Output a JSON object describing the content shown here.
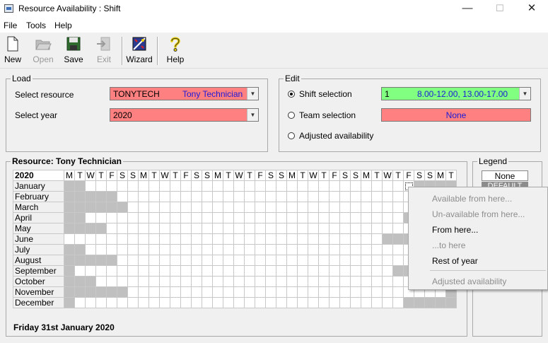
{
  "window": {
    "title": "Resource Availability : Shift",
    "minimize": "—",
    "maximize": "☐",
    "close": "✕"
  },
  "menu": [
    "File",
    "Tools",
    "Help"
  ],
  "toolbar": {
    "new": "New",
    "open": "Open",
    "save": "Save",
    "exit": "Exit",
    "wizard": "Wizard",
    "help": "Help"
  },
  "load": {
    "legend": "Load",
    "resource_label": "Select resource",
    "resource_code": "TONYTECH",
    "resource_name": "Tony Technician",
    "year_label": "Select year",
    "year_value": "2020"
  },
  "edit": {
    "legend": "Edit",
    "shift_label": "Shift selection",
    "shift_code": "1",
    "shift_times": "8.00-12.00, 13.00-17.00",
    "team_label": "Team selection",
    "team_value": "None",
    "adjusted_label": "Adjusted availability",
    "selected_option": "shift"
  },
  "calendar": {
    "legend": "Resource: Tony Technician",
    "year": "2020",
    "day_headers": [
      "M",
      "T",
      "W",
      "T",
      "F",
      "S",
      "S",
      "M",
      "T",
      "W",
      "T",
      "F",
      "S",
      "S",
      "M",
      "T",
      "W",
      "T",
      "F",
      "S",
      "S",
      "M",
      "T",
      "W",
      "T",
      "F",
      "S",
      "S",
      "M",
      "T",
      "W",
      "T",
      "F",
      "S",
      "S",
      "M",
      "T"
    ],
    "months": [
      "January",
      "February",
      "March",
      "April",
      "May",
      "June",
      "July",
      "August",
      "September",
      "October",
      "November",
      "December"
    ],
    "status_date": "Friday 31st January 2020"
  },
  "legend_panel": {
    "legend": "Legend",
    "none_label": "None",
    "default_label": "DEFAULT"
  },
  "context_menu": [
    {
      "label": "Available from here...",
      "enabled": false
    },
    {
      "label": "Un-available from here...",
      "enabled": false
    },
    {
      "label": "From here...",
      "enabled": true
    },
    {
      "label": "...to here",
      "enabled": false
    },
    {
      "label": "Rest of year",
      "enabled": true
    },
    {
      "label": "Adjusted availability",
      "enabled": false
    }
  ],
  "colors": {
    "resource_field": "#ff8080",
    "shift_field": "#80ff80",
    "unavailable_day": "#c0c0c0"
  }
}
